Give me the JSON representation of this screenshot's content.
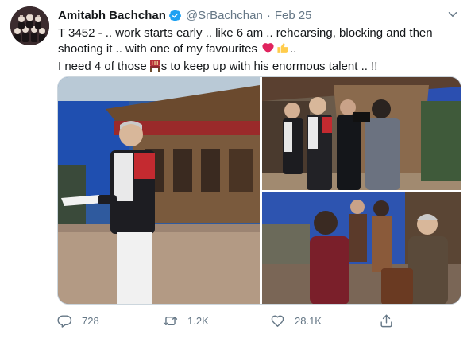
{
  "tweet": {
    "author_name": "Amitabh Bachchan",
    "handle": "@SrBachchan",
    "separator": "·",
    "date": "Feb 25",
    "text_lines": [
      "T 3452 -  .. work starts early .. like 6 am .. rehearsing, blocking and then",
      "shooting it .. with one of my favourites",
      "I need 4 of those",
      "s to keep up with his enormous talent .. !!"
    ],
    "text_line2_end": "..",
    "emojis": [
      "red-heart-emoji",
      "thumbs-up-emoji",
      "chair-emoji"
    ],
    "icons": {
      "verified": "verified-badge-icon",
      "caret": "chevron-down-icon",
      "reply": "reply-icon",
      "retweet": "retweet-icon",
      "like": "like-icon",
      "share": "share-icon"
    },
    "colors": {
      "verified": "#1da1f2",
      "secondary_text": "#657786",
      "heart": "#e0245e"
    }
  },
  "actions": {
    "reply_count": "728",
    "retweet_count": "1.2K",
    "like_count": "28.1K"
  }
}
